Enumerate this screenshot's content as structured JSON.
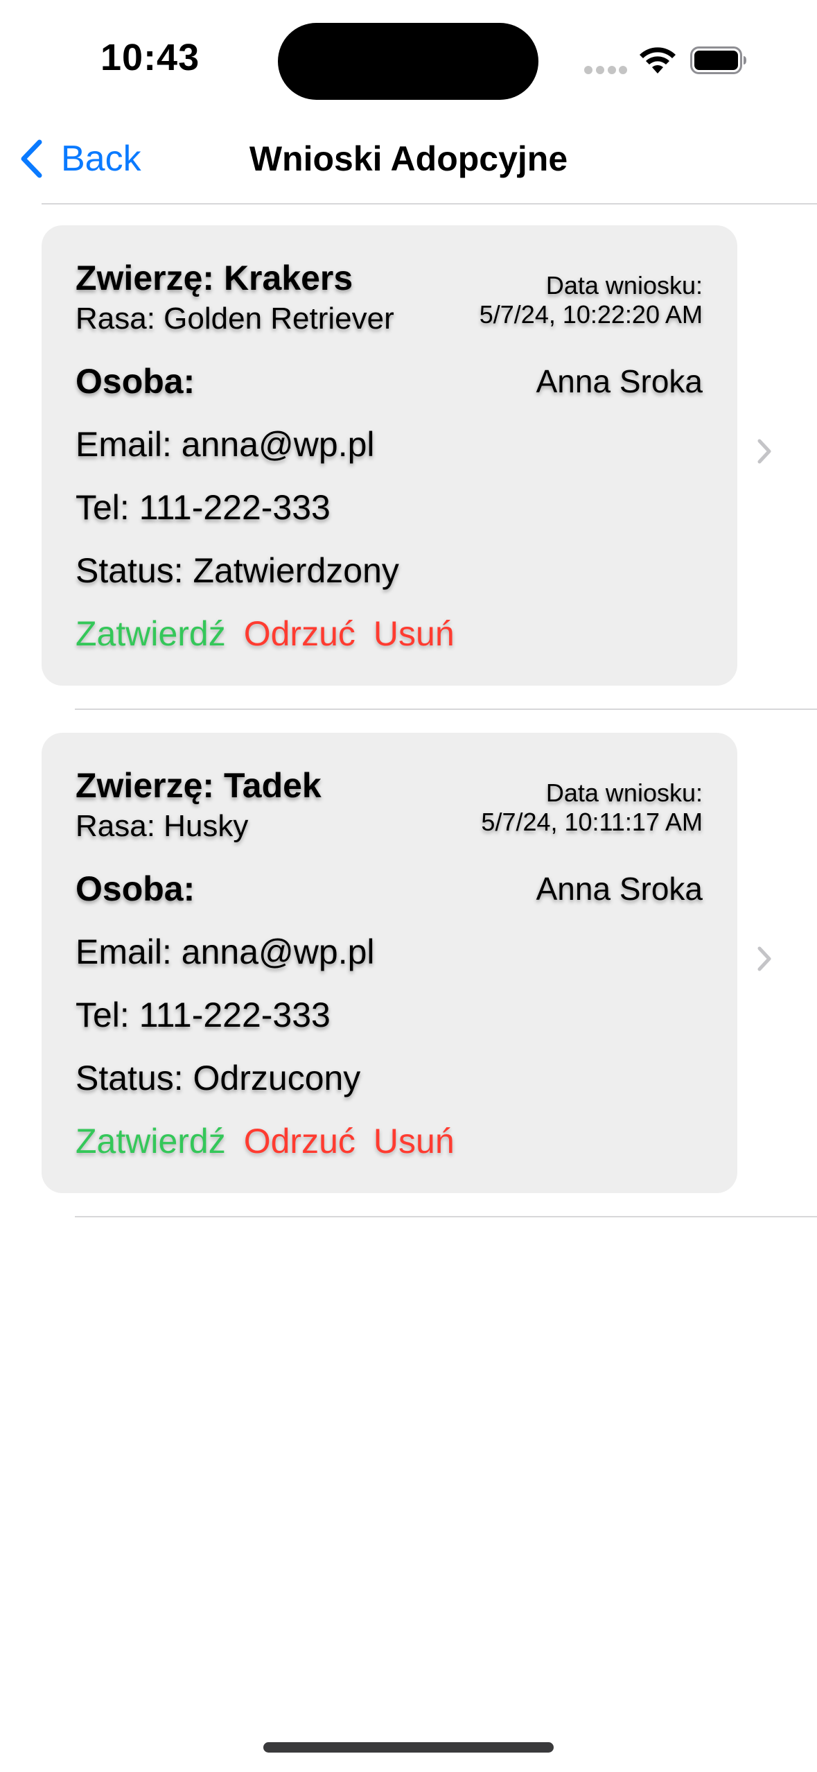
{
  "status_bar": {
    "time": "10:43"
  },
  "nav": {
    "back_label": "Back",
    "title": "Wnioski Adopcyjne",
    "back_icon": "chevron-left-icon"
  },
  "requests": [
    {
      "animal": "Zwierzę: Krakers",
      "breed": "Rasa: Golden Retriever",
      "date_label": "Data wniosku:",
      "date": "5/7/24, 10:22:20 AM",
      "person_label": "Osoba:",
      "person": "Anna Sroka",
      "email": "Email: anna@wp.pl",
      "phone": "Tel: 111-222-333",
      "status": "Status: Zatwierdzony",
      "approve_label": "Zatwierdź",
      "reject_label": "Odrzuć",
      "delete_label": "Usuń"
    },
    {
      "animal": "Zwierzę: Tadek",
      "breed": "Rasa: Husky",
      "date_label": "Data wniosku:",
      "date": "5/7/24, 10:11:17 AM",
      "person_label": "Osoba:",
      "person": "Anna Sroka",
      "email": "Email: anna@wp.pl",
      "phone": "Tel: 111-222-333",
      "status": "Status: Odrzucony",
      "approve_label": "Zatwierdź",
      "reject_label": "Odrzuć",
      "delete_label": "Usuń"
    }
  ],
  "colors": {
    "accent": "#0a7aff",
    "approve": "#34c759",
    "reject": "#ff3b30",
    "card_bg": "#eeeeee"
  }
}
